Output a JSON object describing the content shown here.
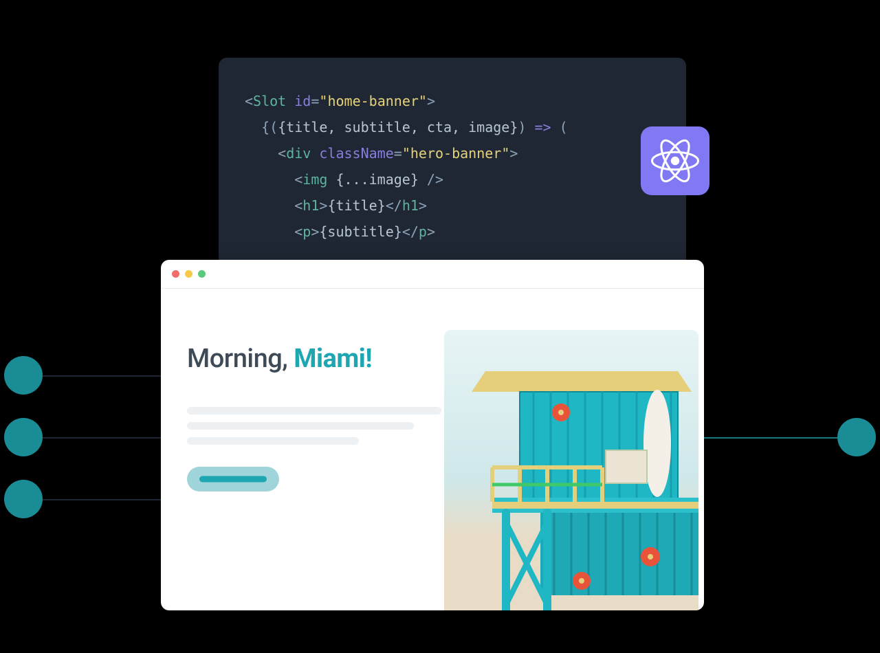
{
  "code": {
    "line1": {
      "open": "<",
      "tag": "Slot",
      "sp": " ",
      "attr": "id",
      "eq": "=",
      "q1": "\"",
      "str": "home-banner",
      "q2": "\"",
      "close": ">"
    },
    "line2": {
      "indent": "  ",
      "text1": "{(",
      "text2": "{title, subtitle, cta, image}",
      "text3": ") ",
      "arrow": "=>",
      "text4": " ("
    },
    "line3": {
      "indent": "    ",
      "open": "<",
      "tag": "div",
      "sp": " ",
      "attr": "className",
      "eq": "=",
      "q1": "\"",
      "str": "hero-banner",
      "q2": "\"",
      "close": ">"
    },
    "line4": {
      "indent": "      ",
      "open": "<",
      "tag": "img",
      "sp": " ",
      "spread": "{...image}",
      "close": " />"
    },
    "line5": {
      "indent": "      ",
      "open": "<",
      "tag1": "h1",
      "close1": ">",
      "content": "{title}",
      "open2": "</",
      "tag2": "h1",
      "close2": ">"
    },
    "line6": {
      "indent": "      ",
      "open": "<",
      "tag1": "p",
      "close1": ">",
      "content": "{subtitle}",
      "open2": "</",
      "tag2": "p",
      "close2": ">"
    }
  },
  "hero": {
    "title_prefix": "Morning, ",
    "title_accent": "Miami!"
  },
  "icons": {
    "react": "react-icon"
  },
  "colors": {
    "teal": "#1a8c95",
    "teal_light": "#9fd4da",
    "code_bg": "#1e2733",
    "react_badge": "#8179f3"
  }
}
